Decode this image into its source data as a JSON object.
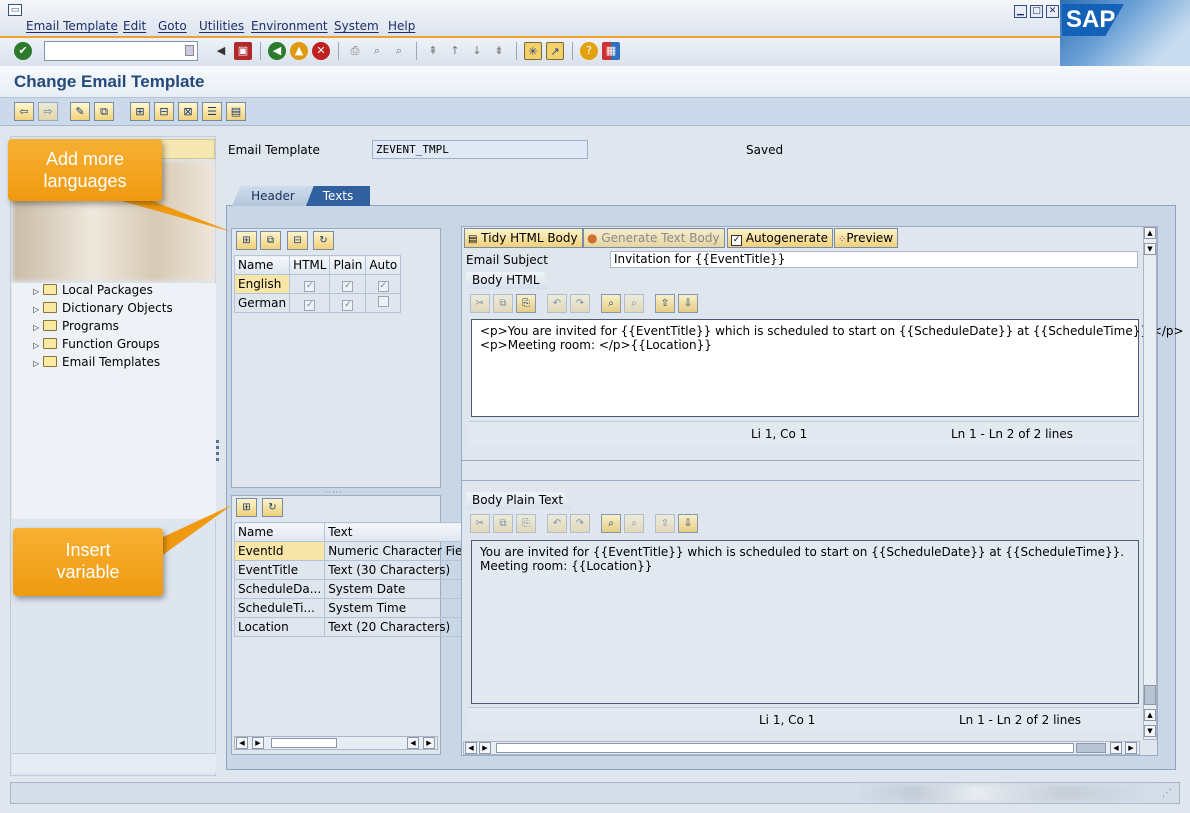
{
  "menu": {
    "items": [
      "Email Template",
      "Edit",
      "Goto",
      "Utilities",
      "Environment",
      "System",
      "Help"
    ]
  },
  "brand": {
    "logo_text": "SAP",
    "accent": "#f0a030",
    "title_color": "#234a7a"
  },
  "page": {
    "title": "Change Email Template"
  },
  "header_fields": {
    "template_label": "Email Template",
    "template_value": "ZEVENT_TMPL",
    "status": "Saved"
  },
  "tabs": {
    "header": "Header",
    "texts": "Texts"
  },
  "tree": {
    "items": [
      "Local Packages",
      "Dictionary Objects",
      "Programs",
      "Function Groups",
      "Email Templates"
    ]
  },
  "languages": {
    "columns": [
      "Name",
      "HTML",
      "Plain",
      "Auto"
    ],
    "rows": [
      {
        "name": "English",
        "html": true,
        "plain": true,
        "auto": true
      },
      {
        "name": "German",
        "html": true,
        "plain": true,
        "auto": false
      }
    ]
  },
  "variables": {
    "columns": [
      "Name",
      "Text"
    ],
    "rows": [
      {
        "name": "EventId",
        "text": "Numeric Character Fiel"
      },
      {
        "name": "EventTitle",
        "text": "Text (30 Characters)"
      },
      {
        "name": "ScheduleDa...",
        "text": "System Date"
      },
      {
        "name": "ScheduleTi...",
        "text": "System Time"
      },
      {
        "name": "Location",
        "text": "Text (20 Characters)"
      }
    ]
  },
  "editor_toolbar": {
    "tidy": "Tidy HTML Body",
    "generate": "Generate Text Body",
    "autogenerate": "Autogenerate",
    "preview": "Preview"
  },
  "subject": {
    "label": "Email Subject",
    "value": "Invitation for {{EventTitle}}"
  },
  "body_html": {
    "title": "Body HTML",
    "line1": "<p>You are invited for {{EventTitle}} which is scheduled to start on {{ScheduleDate}} at {{ScheduleTime}}.</p>",
    "line2": "<p>Meeting room: </p>{{Location}}",
    "cursor": "Li 1, Co 1",
    "lines": "Ln 1 - Ln 2 of 2 lines"
  },
  "body_plain": {
    "title": "Body Plain Text",
    "line1": "You are invited for {{EventTitle}} which is scheduled to start on {{ScheduleDate}} at {{ScheduleTime}}.",
    "line2": "Meeting room: {{Location}}",
    "cursor": "Li 1, Co 1",
    "lines": "Ln 1 - Ln 2 of 2 lines"
  },
  "callouts": {
    "languages": "Add more languages",
    "variable": "Insert variable"
  }
}
